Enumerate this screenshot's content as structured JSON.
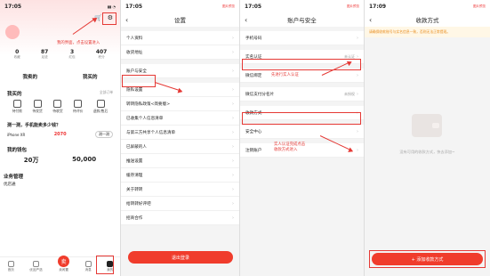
{
  "colors": {
    "accent": "#e53935",
    "button": "#f03c2c"
  },
  "p1": {
    "time": "17:05",
    "stats": [
      {
        "n": "0",
        "l": "收藏"
      },
      {
        "n": "87",
        "l": "足迹"
      },
      {
        "n": "3",
        "l": "红包"
      },
      {
        "n": "407",
        "l": "积分"
      }
    ],
    "my_sold": "我卖的",
    "my_bought": "我买的",
    "all_orders": "全部订单",
    "bought_title": "我买的",
    "bought_icons": [
      "待付款",
      "待发货",
      "待收货",
      "待评价",
      "退款/售后"
    ],
    "phone_q": "测一测，手机能卖多少钱？",
    "phone_model": "iPhone XR",
    "phone_price": "2070",
    "phone_btn": "测一测",
    "wallet": "我的钱包",
    "wallet_amt1": "20万",
    "wallet_amt2": "50,000",
    "biz": "业务管理",
    "biz_item": "优店通",
    "tabs": [
      "首页",
      "优品严选",
      "卖闲置",
      "消息",
      "我的"
    ],
    "sell_label": "卖",
    "anno": "我的界面，点击设置进入"
  },
  "p2": {
    "time": "17:05",
    "app": "图片预览",
    "title": "设置",
    "g1": [
      "个人资料",
      "收货地址"
    ],
    "g2": [
      "账户与安全"
    ],
    "g3": [
      "隐私设置",
      "转转隐私政策<简要版>",
      "已收集个人信息清单",
      "与第三方共享个人信息清单",
      "已屏蔽的人",
      "推送设置",
      "缓存清理",
      "关于转转",
      "给转转好评吧",
      "招商合作"
    ],
    "logout": "退出登录"
  },
  "p3": {
    "time": "17:05",
    "app": "图片预览",
    "title": "账户与安全",
    "phone": "手机号码",
    "realname": "实名认证",
    "realname_val": "未认证",
    "wechat": "微信绑定",
    "wx_public": "微信支付分名片",
    "wx_public_val": "未授权",
    "payment": "收款方式",
    "security": "安全中心",
    "cancel": "注销账户",
    "anno1": "先进行实人认证",
    "anno2": "实人认证完成点击\n收款方式进入"
  },
  "p4": {
    "time": "17:09",
    "app": "图片预览",
    "title": "收款方式",
    "notice": "请确保收款账号与实名信息一致，否则无法正常提现。",
    "empty": "没有可用的收款方式，快去添加~",
    "add_btn": "+ 添加收款方式"
  }
}
